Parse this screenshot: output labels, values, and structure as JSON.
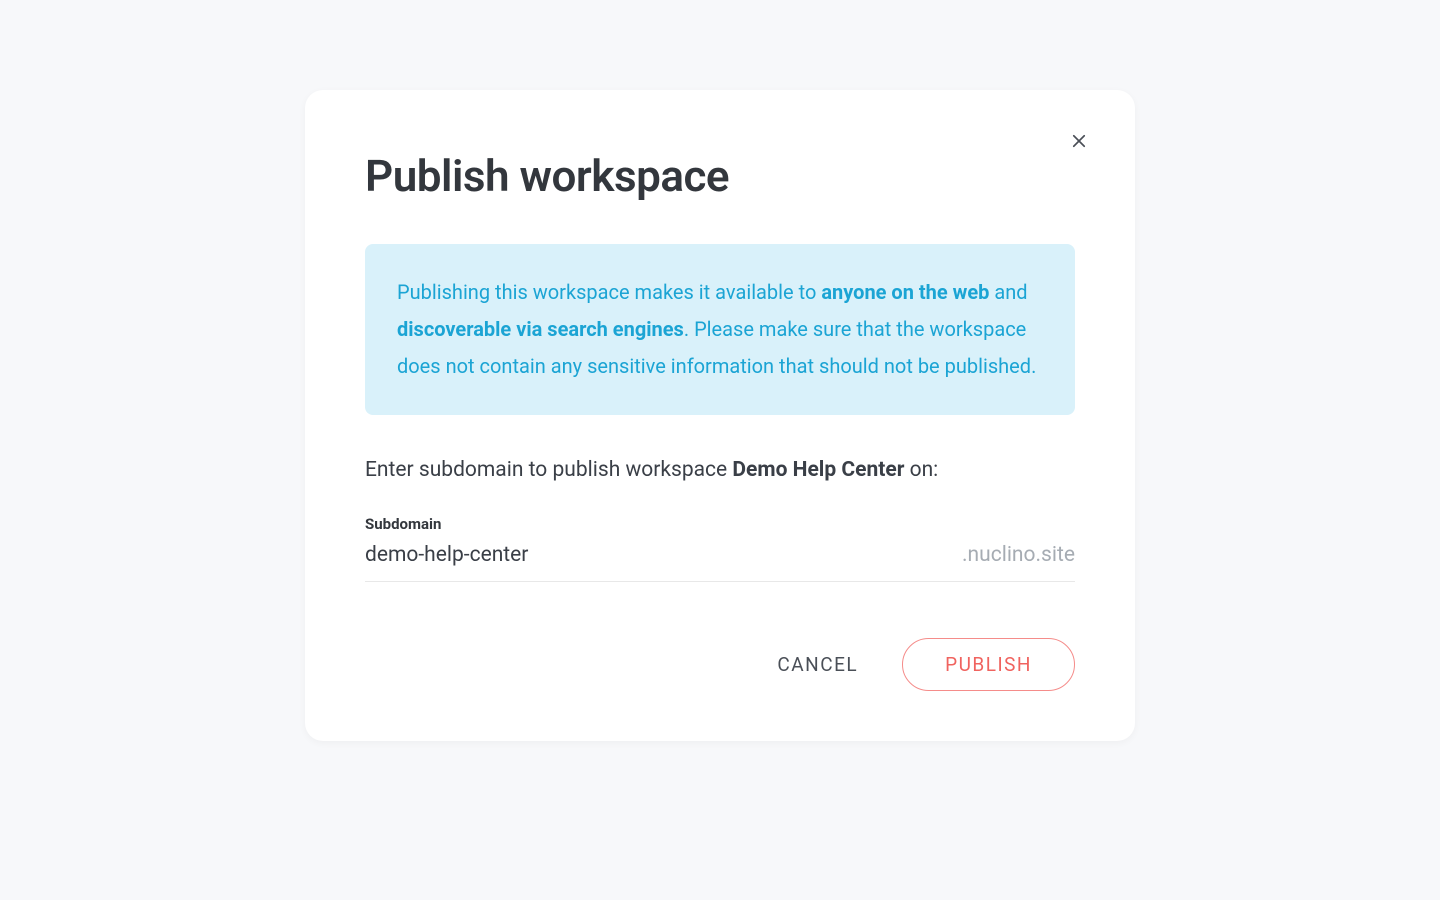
{
  "modal": {
    "title": "Publish workspace",
    "notice": {
      "part1": "Publishing this workspace makes it available to ",
      "bold1": "anyone on the web",
      "part2": " and ",
      "bold2": "discoverable via search engines",
      "part3": ". Please make sure that the workspace does not contain any sensitive information that should not be published."
    },
    "prompt": {
      "before": "Enter subdomain to publish workspace ",
      "workspace_name": "Demo Help Center",
      "after": " on:"
    },
    "field_label": "Subdomain",
    "subdomain_value": "demo-help-center",
    "domain_suffix": ".nuclino.site",
    "actions": {
      "cancel": "CANCEL",
      "publish": "PUBLISH"
    }
  }
}
